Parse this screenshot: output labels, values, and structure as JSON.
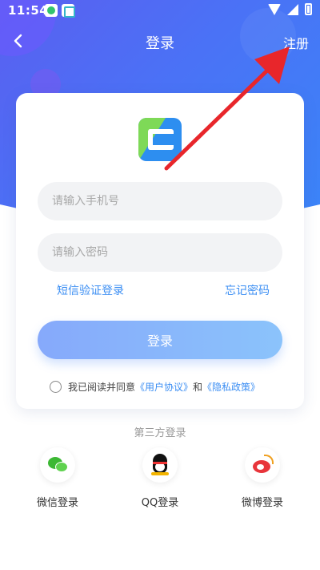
{
  "status_bar": {
    "time": "11:54"
  },
  "nav": {
    "title": "登录",
    "register_label": "注册"
  },
  "form": {
    "phone_placeholder": "请输入手机号",
    "password_placeholder": "请输入密码",
    "sms_login": "短信验证登录",
    "forgot_password": "忘记密码",
    "login_button": "登录",
    "agreement": {
      "prefix": "我已阅读并同意",
      "user_agreement": "《用户协议》",
      "joiner": "和",
      "privacy_policy": "《隐私政策》"
    }
  },
  "third_party": {
    "title": "第三方登录",
    "items": [
      {
        "label": "微信登录",
        "icon": "wechat-icon"
      },
      {
        "label": "QQ登录",
        "icon": "qq-icon"
      },
      {
        "label": "微博登录",
        "icon": "weibo-icon"
      }
    ]
  },
  "colors": {
    "header_gradient_start": "#5a5ff0",
    "header_gradient_end": "#3a86f8",
    "link": "#3b8ef3",
    "annotation_arrow": "#e8262b"
  }
}
